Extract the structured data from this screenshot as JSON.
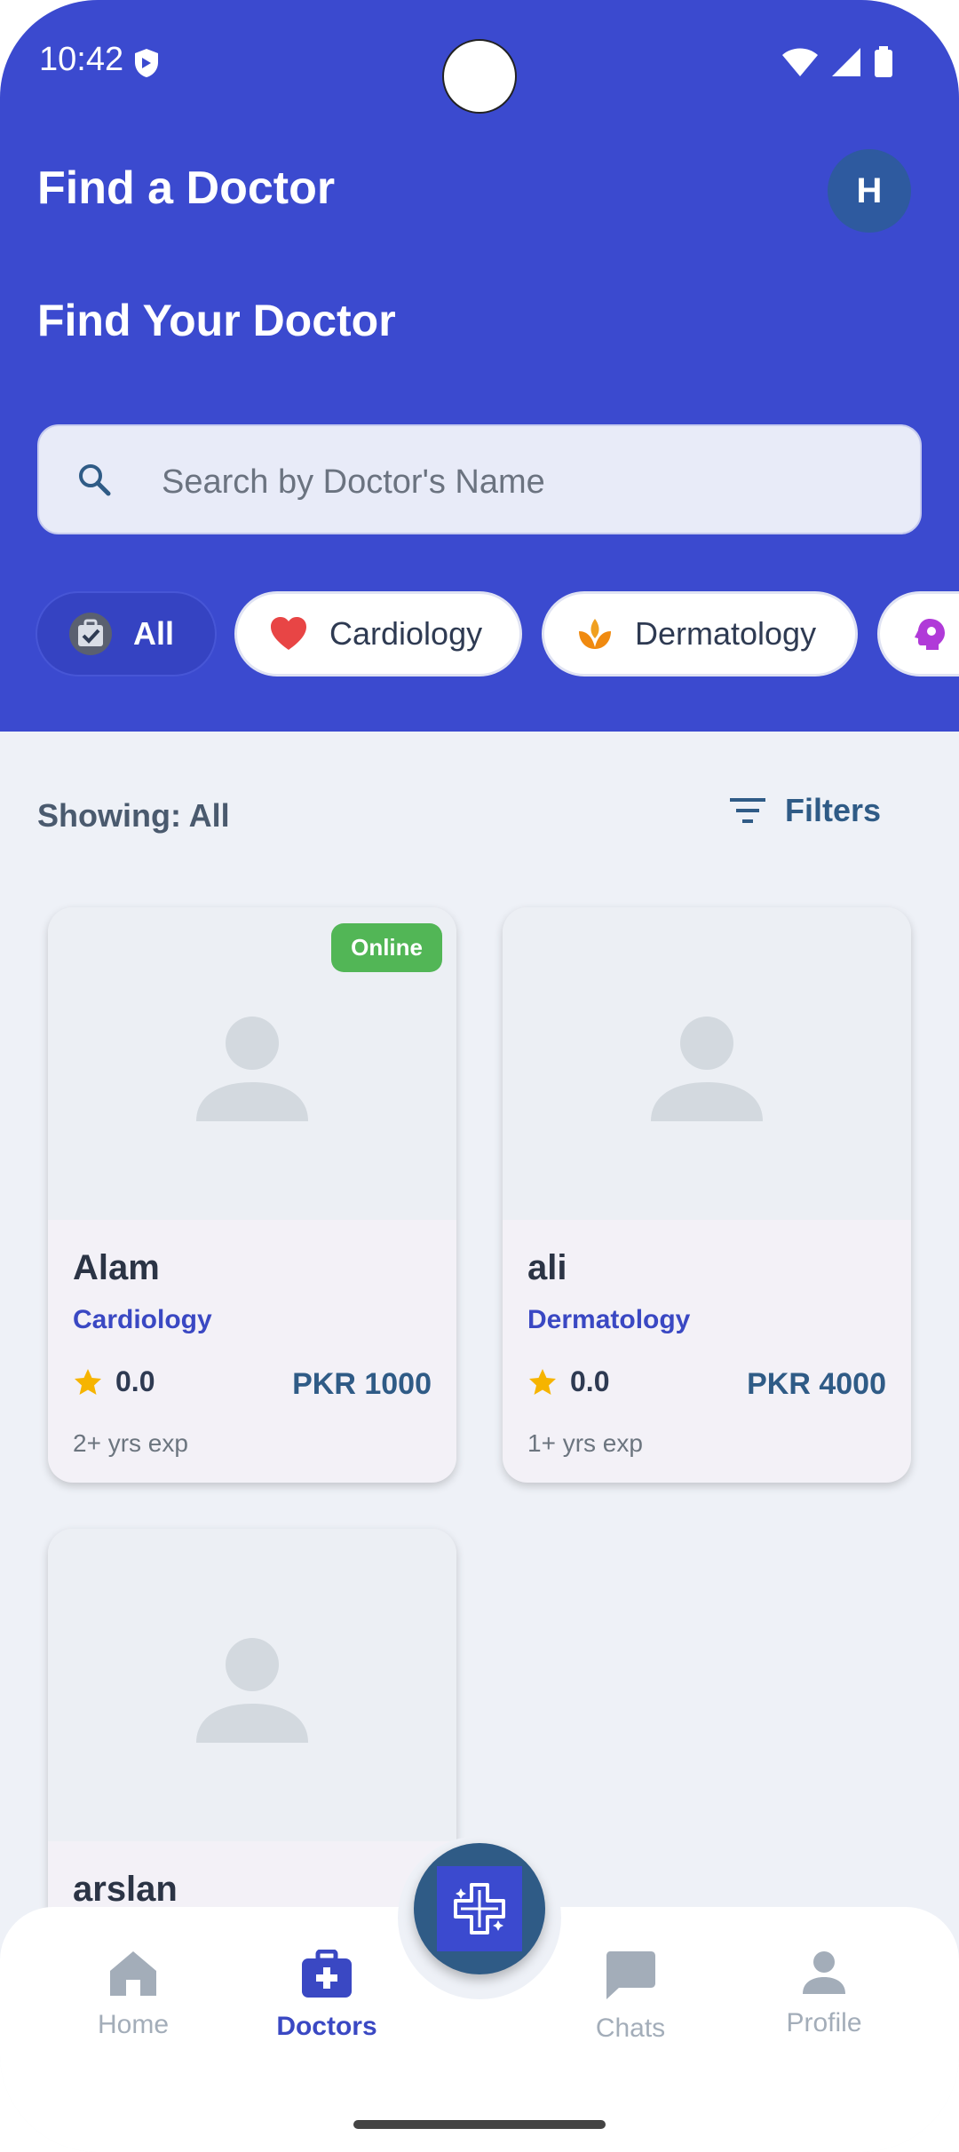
{
  "status_bar": {
    "time": "10:42"
  },
  "header": {
    "app_title": "Find a Doctor",
    "avatar_initial": "H",
    "section_title": "Find Your Doctor",
    "search_placeholder": "Search by Doctor's Name",
    "search_value": ""
  },
  "categories": [
    {
      "label": "All",
      "icon": "medical-bag-icon",
      "selected": true
    },
    {
      "label": "Cardiology",
      "icon": "heart-icon",
      "selected": false
    },
    {
      "label": "Dermatology",
      "icon": "dermatology-icon",
      "selected": false
    },
    {
      "label": "",
      "icon": "brain-icon",
      "selected": false
    }
  ],
  "toolbar": {
    "showing_label": "Showing: All",
    "filters_label": "Filters"
  },
  "doctors": [
    {
      "name": "Alam",
      "specialty": "Cardiology",
      "rating": "0.0",
      "price": "PKR 1000",
      "experience": "2+ yrs exp",
      "status": "Online"
    },
    {
      "name": "ali",
      "specialty": "Dermatology",
      "rating": "0.0",
      "price": "PKR 4000",
      "experience": "1+ yrs exp",
      "status": ""
    },
    {
      "name": "arslan",
      "specialty": "",
      "rating": "",
      "price": "",
      "experience": "",
      "status": ""
    }
  ],
  "bottom_nav": {
    "items": [
      {
        "label": "Home",
        "icon": "home-icon",
        "active": false
      },
      {
        "label": "Doctors",
        "icon": "medical-bag-icon",
        "active": true
      },
      {
        "label": "Chats",
        "icon": "chat-icon",
        "active": false
      },
      {
        "label": "Profile",
        "icon": "person-icon",
        "active": false
      }
    ],
    "fab_icon": "sparkle-plus-icon"
  },
  "colors": {
    "primary": "#3b4acf",
    "accent": "#2f5b86",
    "online": "#52b656",
    "star": "#f6b400"
  }
}
